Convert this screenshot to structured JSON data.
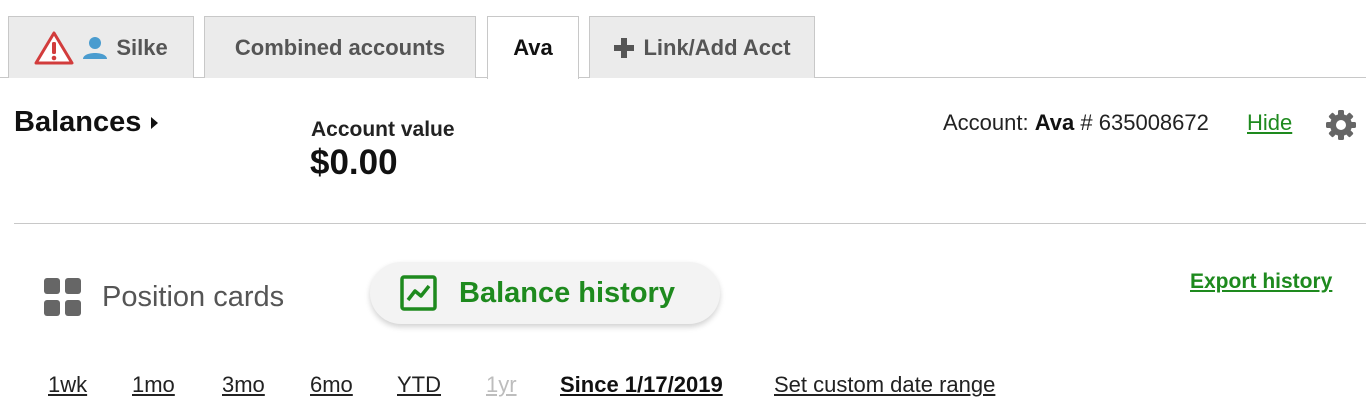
{
  "tabs": [
    {
      "label": "Silke",
      "icons": [
        "warning-icon",
        "user-icon"
      ],
      "state": "inactive"
    },
    {
      "label": "Combined accounts",
      "state": "inactive"
    },
    {
      "label": "Ava",
      "state": "active"
    },
    {
      "label": "Link/Add Acct",
      "icons": [
        "plus-icon"
      ],
      "state": "inactive"
    }
  ],
  "header": {
    "title": "Balances",
    "account_value_label": "Account value",
    "account_value": "$0.00",
    "account_prefix": "Account:",
    "account_name": "Ava",
    "account_number": "# 635008672",
    "hide_label": "Hide"
  },
  "view_toggle": {
    "position_cards": "Position cards",
    "balance_history": "Balance history",
    "selected": "Balance history"
  },
  "export_label": "Export history",
  "ranges": [
    {
      "label": "1wk",
      "state": "enabled"
    },
    {
      "label": "1mo",
      "state": "enabled"
    },
    {
      "label": "3mo",
      "state": "enabled"
    },
    {
      "label": "6mo",
      "state": "enabled"
    },
    {
      "label": "YTD",
      "state": "enabled"
    },
    {
      "label": "1yr",
      "state": "disabled"
    },
    {
      "label": "Since 1/17/2019",
      "state": "selected"
    },
    {
      "label": "Set custom date range",
      "state": "enabled"
    }
  ],
  "colors": {
    "accent_green": "#1e8a1e",
    "warning_red": "#d23c3c",
    "user_blue": "#4a9ccf"
  }
}
